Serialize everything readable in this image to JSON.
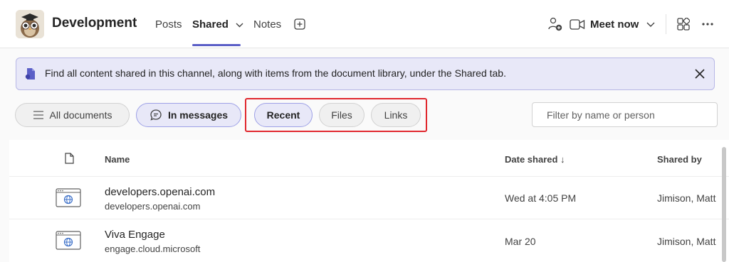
{
  "header": {
    "channel_title": "Development",
    "tabs": [
      {
        "label": "Posts"
      },
      {
        "label": "Shared"
      },
      {
        "label": "Notes"
      }
    ],
    "meet_now_label": "Meet now",
    "icons": [
      "owl-avatar",
      "chevron-down-icon",
      "add-tab-icon",
      "people-add-icon",
      "video-camera-icon",
      "apps-icon",
      "more-icon"
    ]
  },
  "banner": {
    "text": "Find all content shared in this channel, along with items from the document library, under the Shared tab."
  },
  "filters": {
    "all_documents": "All documents",
    "in_messages": "In messages",
    "recent": "Recent",
    "files": "Files",
    "links": "Links",
    "search_placeholder": "Filter by name or person"
  },
  "table": {
    "columns": {
      "name": "Name",
      "date": "Date shared ↓",
      "by": "Shared by"
    },
    "rows": [
      {
        "title": "developers.openai.com",
        "subtitle": "developers.openai.com",
        "date": "Wed at 4:05 PM",
        "shared_by": "Jimison, Matt"
      },
      {
        "title": "Viva Engage",
        "subtitle": "engage.cloud.microsoft",
        "date": "Mar 20",
        "shared_by": "Jimison, Matt"
      }
    ]
  },
  "colors": {
    "accent": "#5b5fc7",
    "highlight": "#e0272d",
    "banner_bg": "#e8e8f8"
  }
}
